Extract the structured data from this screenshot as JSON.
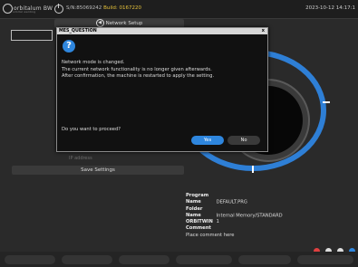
{
  "header": {
    "logo_text": "orbitalum BW",
    "logo_sub": "orbital welding",
    "serial": "S/N:85069242",
    "build": "Build: 0167220",
    "datetime": "2023-10-12 14:17:1"
  },
  "network_setup_label": "Network Setup",
  "faded_label": "IP address",
  "save_settings_label": "Save Settings",
  "program": {
    "rows": [
      {
        "label": "Program Name",
        "value": "DEFAULT.PRG"
      },
      {
        "label": "Folder Name",
        "value": "Internal Memory/STANDARD"
      },
      {
        "label": "ORBITWIN",
        "value": "1"
      },
      {
        "label": "Comment",
        "value": ""
      }
    ],
    "comment": "Place comment here"
  },
  "dialog": {
    "title": "MES_QUESTION",
    "close_glyph": "x",
    "icon_glyph": "?",
    "lines": [
      "Network mode is changed.",
      "The current network functionality is no longer given afterwards.",
      "After confirmation, the machine is restarted to apply the setting."
    ],
    "prompt": "Do you want to proceed?",
    "yes_label": "Yes",
    "no_label": "No"
  },
  "colors": {
    "accent": "#2e86de",
    "build": "#e6c23a"
  }
}
